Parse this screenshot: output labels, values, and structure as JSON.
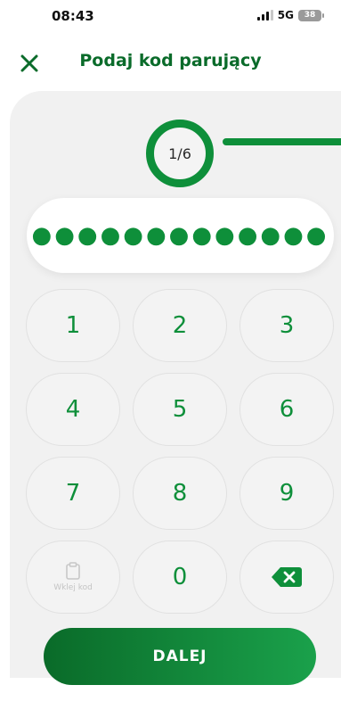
{
  "status_bar": {
    "time": "08:43",
    "network": "5G",
    "battery": "38"
  },
  "header": {
    "title": "Podaj kod parujący",
    "close_icon": "close-icon"
  },
  "progress": {
    "step_label": "1/6"
  },
  "code_field": {
    "masked_value": "●●●●●●●●●●●●●"
  },
  "keypad": {
    "keys": [
      "1",
      "2",
      "3",
      "4",
      "5",
      "6",
      "7",
      "8",
      "9"
    ],
    "zero": "0",
    "paste_label": "Wklej kod",
    "paste_icon": "clipboard-icon",
    "backspace_icon": "backspace-icon"
  },
  "actions": {
    "next_label": "DALEJ"
  },
  "colors": {
    "accent": "#0e8f3a",
    "title": "#0a6b2a",
    "panel": "#f1f1f1"
  }
}
